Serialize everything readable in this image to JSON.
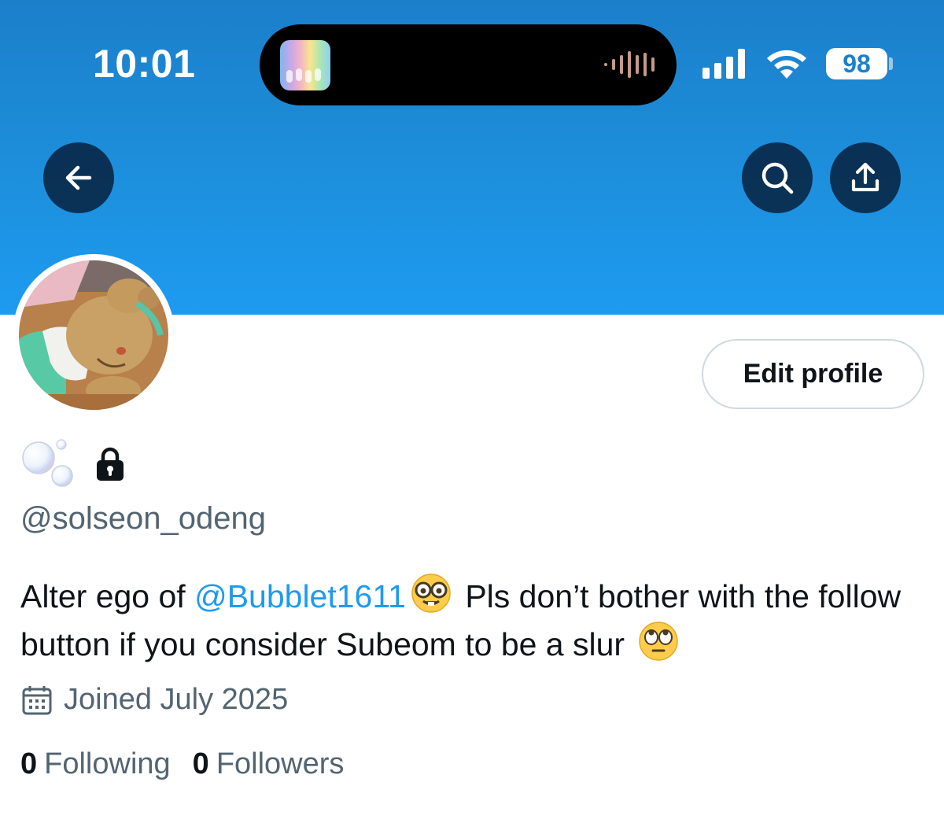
{
  "status_bar": {
    "time": "10:01",
    "battery": "98",
    "icons": [
      "cellular-signal-icon",
      "wifi-icon",
      "battery-icon"
    ]
  },
  "dynamic_island": {
    "icons": [
      "album-art-icon",
      "audio-waveform-icon"
    ]
  },
  "header": {
    "back_icon": "arrow-left-icon",
    "search_icon": "search-icon",
    "share_icon": "share-icon"
  },
  "profile": {
    "display_icons": [
      "bubbles-emoji-icon",
      "lock-icon"
    ],
    "handle": "@solseon_odeng",
    "edit_button": "Edit profile",
    "bio": {
      "part1": "Alter ego of ",
      "mention": "@Bubblet1611",
      "part2": " Pls don’t bother with the follow button if you consider Subeom to be a slur ",
      "emojis": [
        "nerd-face-emoji-icon",
        "eye-roll-emoji-icon"
      ]
    },
    "joined": "Joined July 2025",
    "following_count": "0",
    "following_label": "Following",
    "followers_count": "0",
    "followers_label": "Followers"
  },
  "colors": {
    "banner_top": "#1c7fca",
    "banner_bottom": "#1d9bf0",
    "accent": "#1d9bf0",
    "secondary_text": "#536471",
    "primary_text": "#0f1419"
  }
}
